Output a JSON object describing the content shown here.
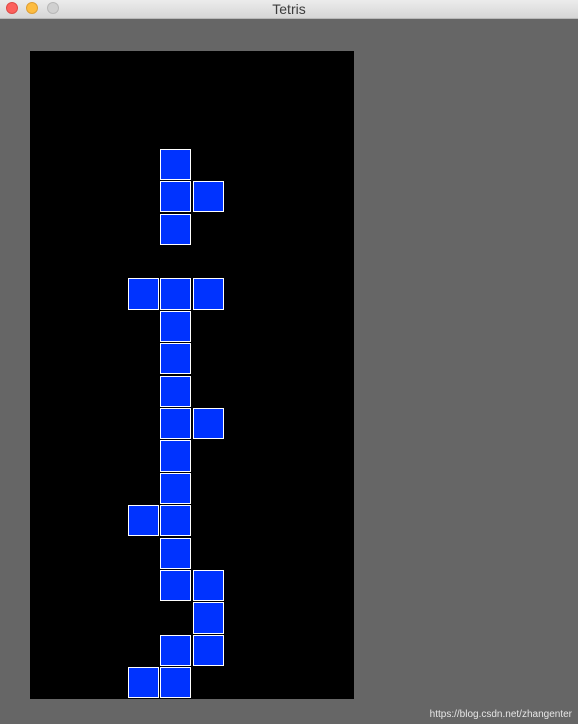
{
  "window": {
    "title": "Tetris"
  },
  "board": {
    "columns": 10,
    "rows": 20,
    "background": "#000000",
    "block_color": "#0033ff",
    "block_border_color": "#ffffff",
    "cells": [
      [
        4,
        3
      ],
      [
        4,
        4
      ],
      [
        5,
        4
      ],
      [
        4,
        5
      ],
      [
        3,
        7
      ],
      [
        4,
        7
      ],
      [
        5,
        7
      ],
      [
        4,
        8
      ],
      [
        4,
        9
      ],
      [
        4,
        10
      ],
      [
        4,
        11
      ],
      [
        5,
        11
      ],
      [
        4,
        12
      ],
      [
        4,
        13
      ],
      [
        3,
        14
      ],
      [
        4,
        14
      ],
      [
        4,
        15
      ],
      [
        4,
        16
      ],
      [
        5,
        16
      ],
      [
        5,
        17
      ],
      [
        4,
        18
      ],
      [
        5,
        18
      ],
      [
        3,
        19
      ],
      [
        4,
        19
      ]
    ]
  },
  "watermark": "https://blog.csdn.net/zhangenter"
}
